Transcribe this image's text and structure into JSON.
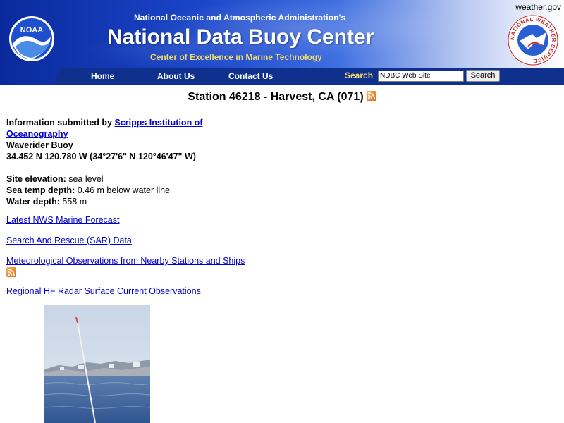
{
  "header": {
    "top_line": "National Oceanic and Atmospheric Administration's",
    "title": "National Data Buoy Center",
    "subtitle": "Center of Excellence in Marine Technology",
    "weather_link": "weather.gov",
    "noaa_logo_text": "NOAA",
    "nws_logo_text": "NATIONAL WEATHER SERVICE"
  },
  "nav": {
    "items": [
      {
        "label": "Home"
      },
      {
        "label": "About Us"
      },
      {
        "label": "Contact Us"
      }
    ],
    "search_label": "Search",
    "search_value": "NDBC Web Site",
    "search_button": "Search"
  },
  "station": {
    "title": "Station 46218 - Harvest, CA (071)",
    "info_prefix": "Information submitted by",
    "info_link": "Scripps Institution of Oceanography",
    "type": "Waverider Buoy",
    "coords": "34.452 N 120.780 W (34°27'6\" N 120°46'47\" W)",
    "site_elevation_label": "Site elevation:",
    "site_elevation_value": "sea level",
    "sea_temp_depth_label": "Sea temp depth:",
    "sea_temp_depth_value": "0.46 m below water line",
    "water_depth_label": "Water depth:",
    "water_depth_value": "558 m"
  },
  "links": {
    "marine_forecast": "Latest NWS Marine Forecast",
    "sar": "Search And Rescue (SAR) Data",
    "met_obs": "Meteorological Observations from Nearby Stations and Ships",
    "hf_radar": "Regional HF Radar Surface Current Observations"
  },
  "colors": {
    "header_dark": "#0a2a9c",
    "nav_bar": "#10308e",
    "subtitle_gold": "#f3dc6a",
    "link_blue": "#0000cc",
    "rss_orange": "#e06b12"
  },
  "icons": {
    "rss": "rss-icon",
    "noaa": "noaa-logo",
    "nws": "nws-logo"
  }
}
